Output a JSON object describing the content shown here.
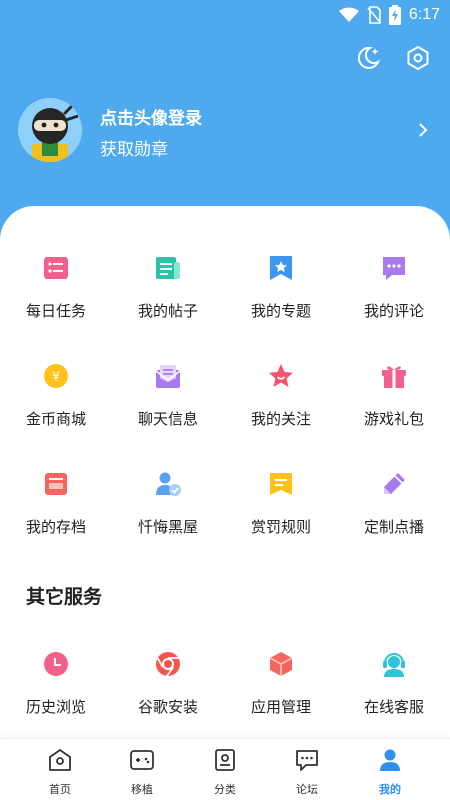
{
  "status_bar": {
    "time": "6:17",
    "icons": [
      "wifi-icon",
      "no-sim-icon",
      "battery-charging-icon"
    ]
  },
  "header": {
    "actions": [
      "night-mode-icon",
      "settings-icon"
    ]
  },
  "profile": {
    "title": "点击头像登录",
    "subtitle": "获取勋章"
  },
  "grid": [
    {
      "label": "每日任务",
      "icon": "task-list-icon",
      "color": "#f4608c"
    },
    {
      "label": "我的帖子",
      "icon": "post-icon",
      "color": "#2cc4a8"
    },
    {
      "label": "我的专题",
      "icon": "topic-bookmark-icon",
      "color": "#3d97ee"
    },
    {
      "label": "我的评论",
      "icon": "comment-icon",
      "color": "#a77bef"
    },
    {
      "label": "金币商城",
      "icon": "coin-icon",
      "color": "#ffc21c"
    },
    {
      "label": "聊天信息",
      "icon": "mail-icon",
      "color": "#a77bef"
    },
    {
      "label": "我的关注",
      "icon": "star-icon",
      "color": "#f5546e"
    },
    {
      "label": "游戏礼包",
      "icon": "gift-icon",
      "color": "#f4608c"
    },
    {
      "label": "我的存档",
      "icon": "archive-icon",
      "color": "#f5665e"
    },
    {
      "label": "忏悔黑屋",
      "icon": "user-verify-icon",
      "color": "#5aa0f0"
    },
    {
      "label": "赏罚规则",
      "icon": "rules-icon",
      "color": "#ffc21c"
    },
    {
      "label": "定制点播",
      "icon": "edit-pencil-icon",
      "color": "#a77bef"
    }
  ],
  "other_services": {
    "title": "其它服务",
    "items": [
      {
        "label": "历史浏览",
        "icon": "clock-icon",
        "color": "#f4608c"
      },
      {
        "label": "谷歌安装",
        "icon": "chrome-icon",
        "color": "#f5554e"
      },
      {
        "label": "应用管理",
        "icon": "box-icon",
        "color": "#f5665e"
      },
      {
        "label": "在线客服",
        "icon": "headset-icon",
        "color": "#2cc4d8"
      }
    ]
  },
  "tabbar": [
    {
      "label": "首页",
      "icon": "home-icon",
      "active": false
    },
    {
      "label": "移植",
      "icon": "gamepad-icon",
      "active": false
    },
    {
      "label": "分类",
      "icon": "category-icon",
      "active": false
    },
    {
      "label": "论坛",
      "icon": "forum-icon",
      "active": false
    },
    {
      "label": "我的",
      "icon": "profile-icon",
      "active": true
    }
  ],
  "colors": {
    "header_bg": "#4ea9ef",
    "active_tab": "#2f8ff0"
  }
}
